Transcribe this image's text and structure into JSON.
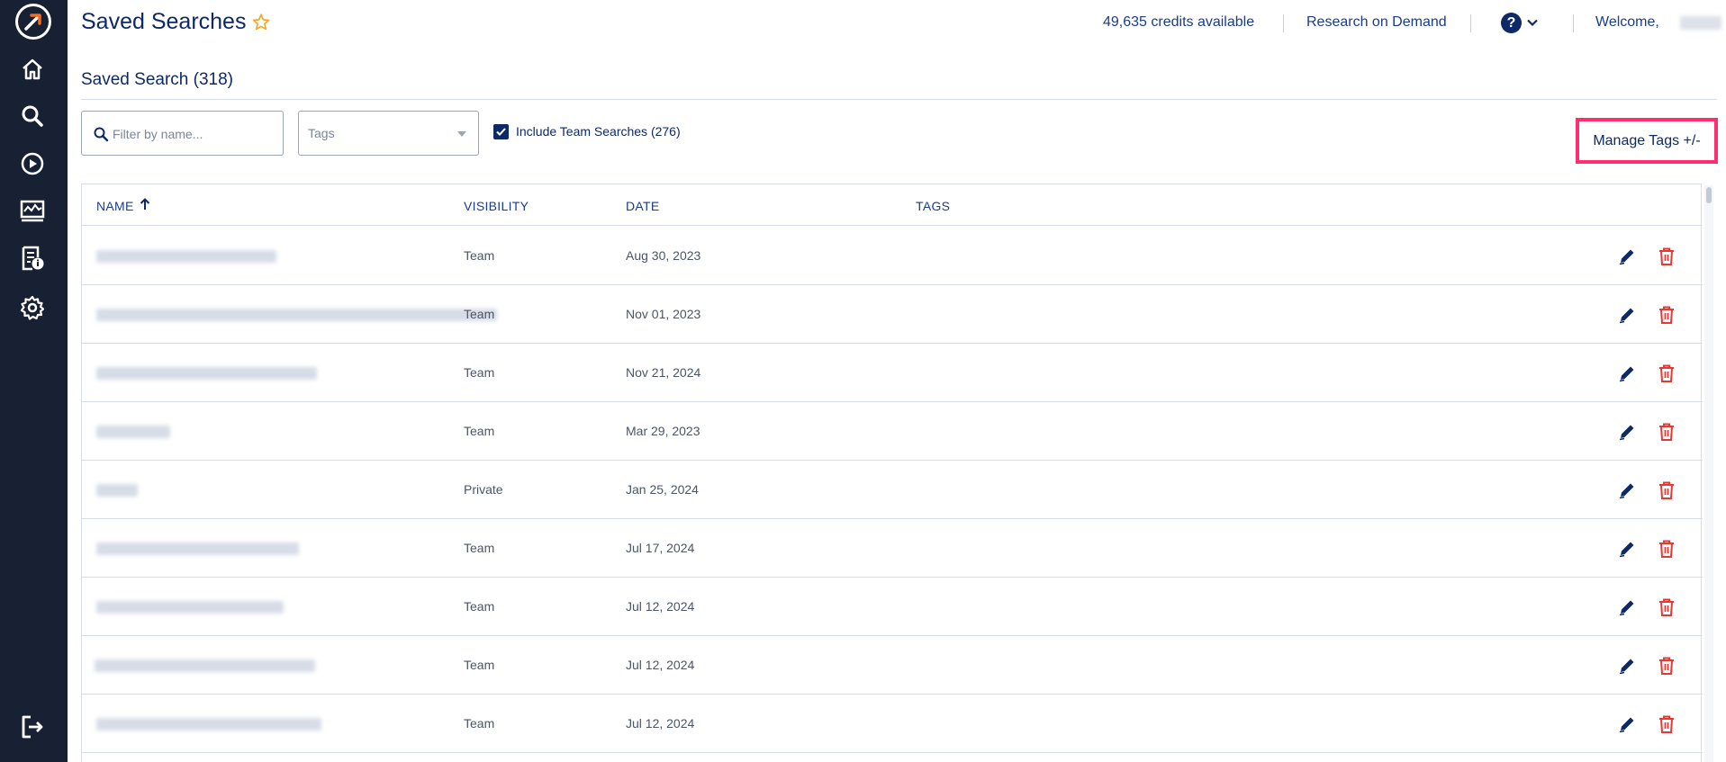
{
  "header": {
    "title": "Saved Searches",
    "credits": "49,635 credits available",
    "research_link": "Research on Demand",
    "help_label": "?",
    "welcome": "Welcome,"
  },
  "sidebar": {
    "items": [
      {
        "icon": "home-icon"
      },
      {
        "icon": "search-icon"
      },
      {
        "icon": "play-icon"
      },
      {
        "icon": "monitor-chart-icon"
      },
      {
        "icon": "report-info-icon"
      },
      {
        "icon": "gear-icon"
      }
    ],
    "logout_icon": "logout-icon"
  },
  "section": {
    "title": "Saved Search (318)"
  },
  "filters": {
    "search_placeholder": "Filter by name...",
    "tags_placeholder": "Tags",
    "include_team_label": "Include Team Searches (276)",
    "include_team_checked": true,
    "manage_tags_label": "Manage Tags +/-"
  },
  "table": {
    "columns": [
      "NAME",
      "VISIBILITY",
      "DATE",
      "TAGS"
    ],
    "rows": [
      {
        "visibility": "Team",
        "date": "Aug 30, 2023"
      },
      {
        "visibility": "Team",
        "date": "Nov 01, 2023"
      },
      {
        "visibility": "Team",
        "date": "Nov 21, 2024"
      },
      {
        "visibility": "Team",
        "date": "Mar 29, 2023"
      },
      {
        "visibility": "Private",
        "date": "Jan 25, 2024"
      },
      {
        "visibility": "Team",
        "date": "Jul 17, 2024"
      },
      {
        "visibility": "Team",
        "date": "Jul 12, 2024"
      },
      {
        "visibility": "Team",
        "date": "Jul 12, 2024"
      },
      {
        "visibility": "Team",
        "date": "Jul 12, 2024"
      }
    ]
  },
  "colors": {
    "sidebar_bg": "#182034",
    "primary": "#0e2a66",
    "accent_orange": "#f26b21",
    "delete_red": "#e53935",
    "highlight": "#ff2e6f",
    "star": "#f5a623"
  }
}
